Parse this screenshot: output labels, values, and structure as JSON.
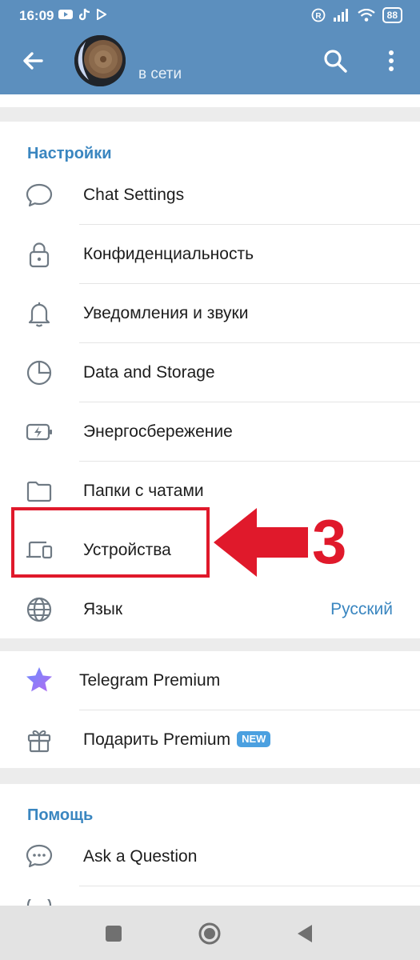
{
  "status_bar": {
    "time": "16:09",
    "battery": "88"
  },
  "header": {
    "status": "в сети"
  },
  "settings": {
    "section_title": "Настройки",
    "items": [
      {
        "label": "Chat Settings",
        "icon": "chat-bubble-icon"
      },
      {
        "label": "Конфиденциальность",
        "icon": "lock-icon"
      },
      {
        "label": "Уведомления и звуки",
        "icon": "bell-icon"
      },
      {
        "label": "Data and Storage",
        "icon": "pie-chart-icon"
      },
      {
        "label": "Энергосбережение",
        "icon": "battery-icon"
      },
      {
        "label": "Папки с чатами",
        "icon": "folder-icon"
      },
      {
        "label": "Устройства",
        "icon": "devices-icon"
      },
      {
        "label": "Язык",
        "icon": "globe-icon",
        "value": "Русский"
      }
    ]
  },
  "premium": {
    "items": [
      {
        "label": "Telegram Premium",
        "icon": "star-icon"
      },
      {
        "label": "Подарить Premium",
        "icon": "gift-icon",
        "badge": "NEW"
      }
    ]
  },
  "help": {
    "section_title": "Помощь",
    "items": [
      {
        "label": "Ask a Question",
        "icon": "question-chat-icon"
      }
    ]
  },
  "annotation": {
    "step": "3",
    "color": "#e0192b"
  },
  "colors": {
    "header": "#5c8fbe",
    "accent": "#3a86c0",
    "badge": "#4ba0e0"
  }
}
